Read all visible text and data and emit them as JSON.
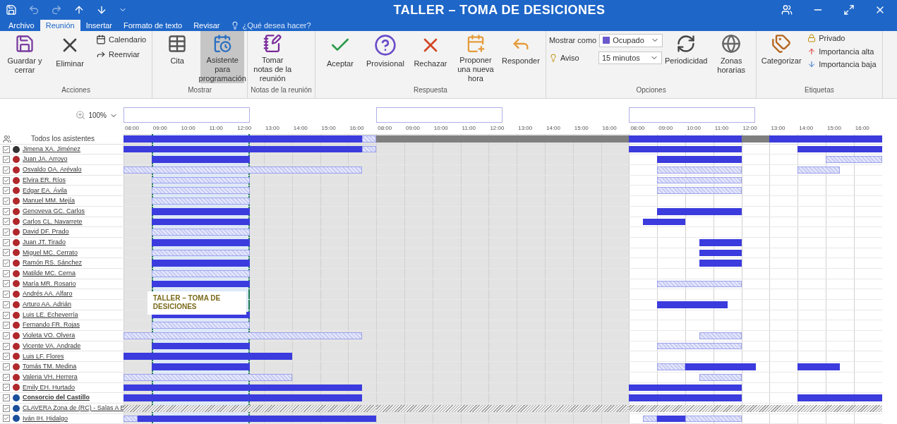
{
  "window": {
    "title": "TALLER – TOMA DE DESICIONES"
  },
  "ribbon_tabs": [
    {
      "label": "Archivo",
      "selected": false
    },
    {
      "label": "Reunión",
      "selected": true
    },
    {
      "label": "Insertar",
      "selected": false
    },
    {
      "label": "Formato de texto",
      "selected": false
    },
    {
      "label": "Revisar",
      "selected": false
    }
  ],
  "tell_me": {
    "placeholder": "¿Qué desea hacer?"
  },
  "ribbon_groups": [
    {
      "label": "Acciones",
      "buttons": [
        {
          "kind": "save",
          "label": "Guardar y cerrar",
          "selected": false
        },
        {
          "kind": "delete",
          "label": "Eliminar",
          "selected": false
        },
        {
          "kind": "small_stack",
          "items": [
            "Calendario",
            "Reenviar"
          ]
        }
      ]
    },
    {
      "label": "Mostrar",
      "buttons": [
        {
          "kind": "appointment",
          "label": "Cita",
          "selected": false
        },
        {
          "kind": "assistant",
          "label": "Asistente para programación",
          "selected": true
        }
      ]
    },
    {
      "label": "Notas de la reunión",
      "buttons": [
        {
          "kind": "onenote",
          "label": "Tomar notas de la reunión",
          "selected": false
        }
      ]
    },
    {
      "label": "Respuesta",
      "buttons": [
        {
          "kind": "accept",
          "label": "Aceptar",
          "selected": false
        },
        {
          "kind": "tentative",
          "label": "Provisional",
          "selected": false
        },
        {
          "kind": "decline",
          "label": "Rechazar",
          "selected": false
        },
        {
          "kind": "propose",
          "label": "Proponer una nueva hora",
          "selected": false
        },
        {
          "kind": "reply",
          "label": "Responder",
          "selected": false
        }
      ]
    },
    {
      "label": "Opciones",
      "buttons": [
        {
          "kind": "options",
          "show_as_label": "Mostrar como",
          "show_as": "Ocupado",
          "reminder_label": "Aviso",
          "reminder": "15 minutos"
        },
        {
          "kind": "recurrence",
          "label": "Periodicidad",
          "selected": false
        },
        {
          "kind": "timezones",
          "label": "Zonas horarias",
          "selected": false
        }
      ]
    },
    {
      "label": "Etiquetas",
      "buttons": [
        {
          "kind": "categorize",
          "label": "Categorizar",
          "selected": false
        },
        {
          "kind": "tag_stack",
          "items": [
            "Privado",
            "Importancia alta",
            "Importancia baja"
          ]
        }
      ]
    }
  ],
  "zoom": "100%",
  "days": [
    {
      "shaded": true,
      "hours": [
        "08:00",
        "09:00",
        "10:00",
        "11:00",
        "12:00",
        "13:00",
        "14:00",
        "15:00",
        "16:00"
      ]
    },
    {
      "shaded": true,
      "hours": [
        "08:00",
        "09:00",
        "10:00",
        "11:00",
        "12:00",
        "13:00",
        "14:00",
        "15:00",
        "16:00"
      ]
    },
    {
      "shaded": false,
      "hours": [
        "08:00",
        "09:00",
        "10:00",
        "11:00",
        "12:00",
        "13:00",
        "14:00",
        "15:00",
        "16:00"
      ]
    }
  ],
  "all_attendees": {
    "label": "Todos los asistentes"
  },
  "attendees": [
    {
      "name": "Jimena XA. Jiménez",
      "kind": "organizer",
      "checked": true
    },
    {
      "name": "Juan JA. Arroyo",
      "kind": "required",
      "checked": true
    },
    {
      "name": "Osvaldo OA. Arévalo",
      "kind": "required",
      "checked": true
    },
    {
      "name": "Elvira ER. Ríos",
      "kind": "required",
      "checked": true
    },
    {
      "name": "Edgar EA. Ávila",
      "kind": "required",
      "checked": true
    },
    {
      "name": "Manuel MM. Mejía",
      "kind": "required",
      "checked": true
    },
    {
      "name": "Genoveva GC. Carlos",
      "kind": "required",
      "checked": true
    },
    {
      "name": "Carlos CL. Navarrete",
      "kind": "required",
      "checked": true
    },
    {
      "name": "David DF. Prado",
      "kind": "required",
      "checked": true
    },
    {
      "name": "Juan JT. Tirado",
      "kind": "required",
      "checked": true
    },
    {
      "name": "Miguel MC. Cerrato",
      "kind": "required",
      "checked": true
    },
    {
      "name": "Ramón RS. Sánchez",
      "kind": "required",
      "checked": true
    },
    {
      "name": "Matilde MC. Cerna",
      "kind": "required",
      "checked": true
    },
    {
      "name": "María MR. Rosario",
      "kind": "required",
      "checked": true
    },
    {
      "name": "Andrés AA. Alfaro",
      "kind": "required",
      "checked": true
    },
    {
      "name": "Arturo AA. Adrián",
      "kind": "required",
      "checked": true
    },
    {
      "name": "Luis LE. Echeverría",
      "kind": "required",
      "checked": true
    },
    {
      "name": "Fernando FR. Rojas",
      "kind": "required",
      "checked": true
    },
    {
      "name": "Violeta VO. Olvera",
      "kind": "required",
      "checked": true
    },
    {
      "name": "Vicente VA. Andrade",
      "kind": "required",
      "checked": true
    },
    {
      "name": "Luis LF. Flores",
      "kind": "required",
      "checked": true
    },
    {
      "name": "Tomás TM. Medina",
      "kind": "required",
      "checked": true
    },
    {
      "name": "Valeria VH. Herrera",
      "kind": "required",
      "checked": true
    },
    {
      "name": "Emily EH. Hurtado",
      "kind": "required",
      "checked": true
    },
    {
      "name": "Consorcio del Castillo",
      "kind": "optional",
      "checked": true
    },
    {
      "name": "CLAVERA Zona de (RC) - Salas A B",
      "kind": "resource",
      "checked": true
    },
    {
      "name": "Iván IH. Hidalgo",
      "kind": "resource",
      "checked": true
    }
  ],
  "tooltip": {
    "text": "TALLER – TOMA DE DESICIONES"
  }
}
